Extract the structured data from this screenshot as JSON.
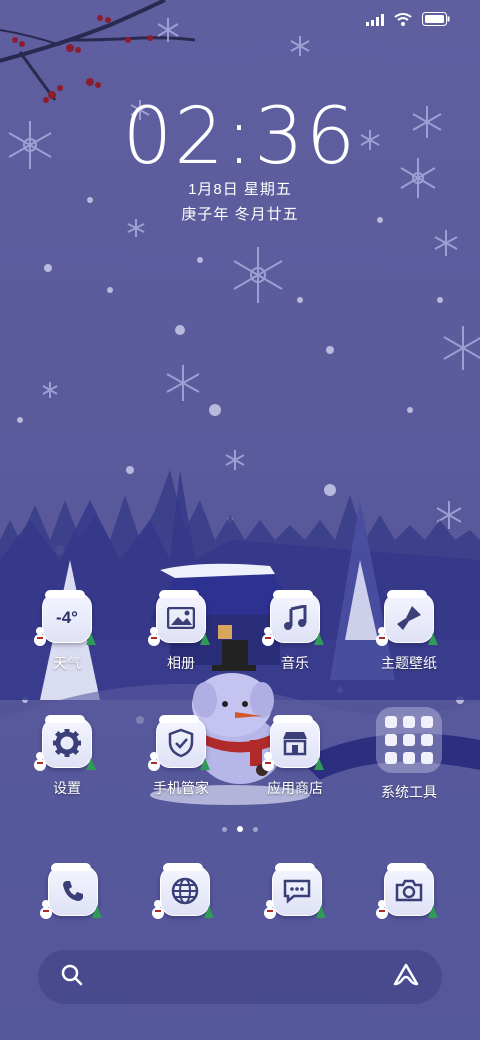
{
  "status_bar": {
    "signal_icon": "cellular-signal-icon",
    "wifi_icon": "wifi-icon",
    "battery_icon": "battery-icon"
  },
  "lock_widget": {
    "time": "02:36",
    "date": "1月8日 星期五",
    "lunar_date": "庚子年 冬月廿五"
  },
  "apps_row1": [
    {
      "label": "天气",
      "icon": "weather-icon",
      "icon_text": "-4°"
    },
    {
      "label": "相册",
      "icon": "gallery-icon"
    },
    {
      "label": "音乐",
      "icon": "music-icon"
    },
    {
      "label": "主题壁纸",
      "icon": "theme-brush-icon"
    }
  ],
  "apps_row2": [
    {
      "label": "设置",
      "icon": "gear-icon"
    },
    {
      "label": "手机管家",
      "icon": "shield-check-icon"
    },
    {
      "label": "应用商店",
      "icon": "store-icon"
    },
    {
      "label": "系统工具",
      "icon": "folder-icon"
    }
  ],
  "dock": [
    {
      "icon": "phone-icon"
    },
    {
      "icon": "browser-globe-icon"
    },
    {
      "icon": "messages-icon"
    },
    {
      "icon": "camera-icon"
    }
  ],
  "page_indicator": {
    "pages": 3,
    "active": 2
  },
  "search_bar": {
    "left_icon": "search-icon",
    "right_icon": "assistant-icon"
  },
  "colors": {
    "background": "#5b5b9c",
    "icon_glyph": "#3b3f78",
    "snow": "#ffffff"
  }
}
